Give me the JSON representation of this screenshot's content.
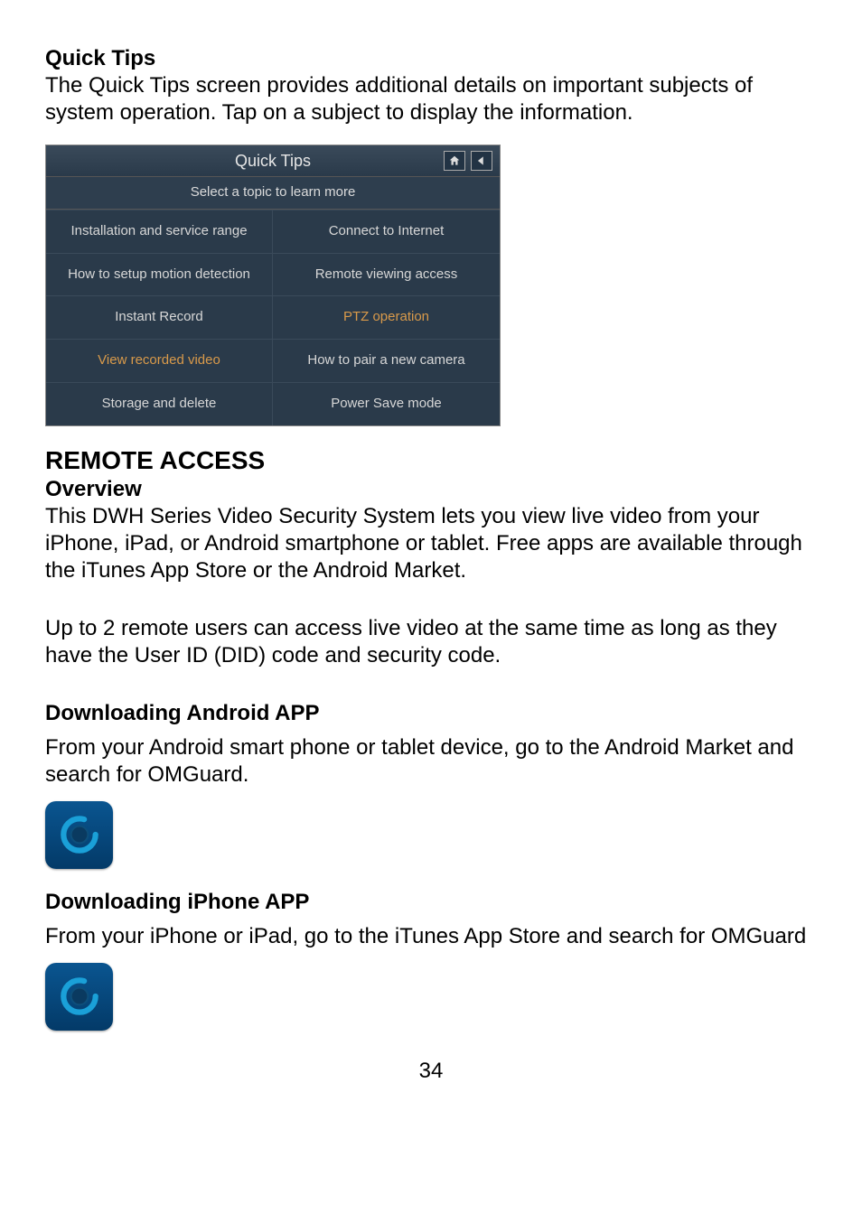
{
  "quick_tips": {
    "heading": "Quick Tips",
    "desc": "The Quick Tips screen provides additional details on important subjects of system operation. Tap on a subject to display the information."
  },
  "device": {
    "title": "Quick Tips",
    "subtitle": "Select a topic to learn more",
    "topics": [
      {
        "label": "Installation and service range",
        "highlight": false
      },
      {
        "label": "Connect to Internet",
        "highlight": false
      },
      {
        "label": "How to setup motion detection",
        "highlight": false
      },
      {
        "label": "Remote viewing access",
        "highlight": false
      },
      {
        "label": "Instant Record",
        "highlight": false
      },
      {
        "label": "PTZ  operation",
        "highlight": true
      },
      {
        "label": "View recorded video",
        "highlight": true
      },
      {
        "label": "How to pair a new camera",
        "highlight": false
      },
      {
        "label": "Storage and delete",
        "highlight": false
      },
      {
        "label": "Power Save mode",
        "highlight": false
      }
    ]
  },
  "remote_access": {
    "title": "REMOTE ACCESS",
    "overview_heading": "Overview",
    "overview_p1": "This DWH Series Video Security System lets you view live video from your iPhone, iPad, or Android smartphone or tablet. Free apps are available through the iTunes App Store or the Android Market.",
    "overview_p2": "Up to 2 remote users can access live video at the same time as long as they have the User ID (DID) code and security code.",
    "android_heading": "Downloading Android APP",
    "android_body": "From your Android smart phone or tablet device, go to the Android Market and search for OMGuard.",
    "iphone_heading": "Downloading iPhone APP",
    "iphone_body": "From your iPhone or iPad, go to the iTunes App Store and search for OMGuard"
  },
  "page_number": "34"
}
